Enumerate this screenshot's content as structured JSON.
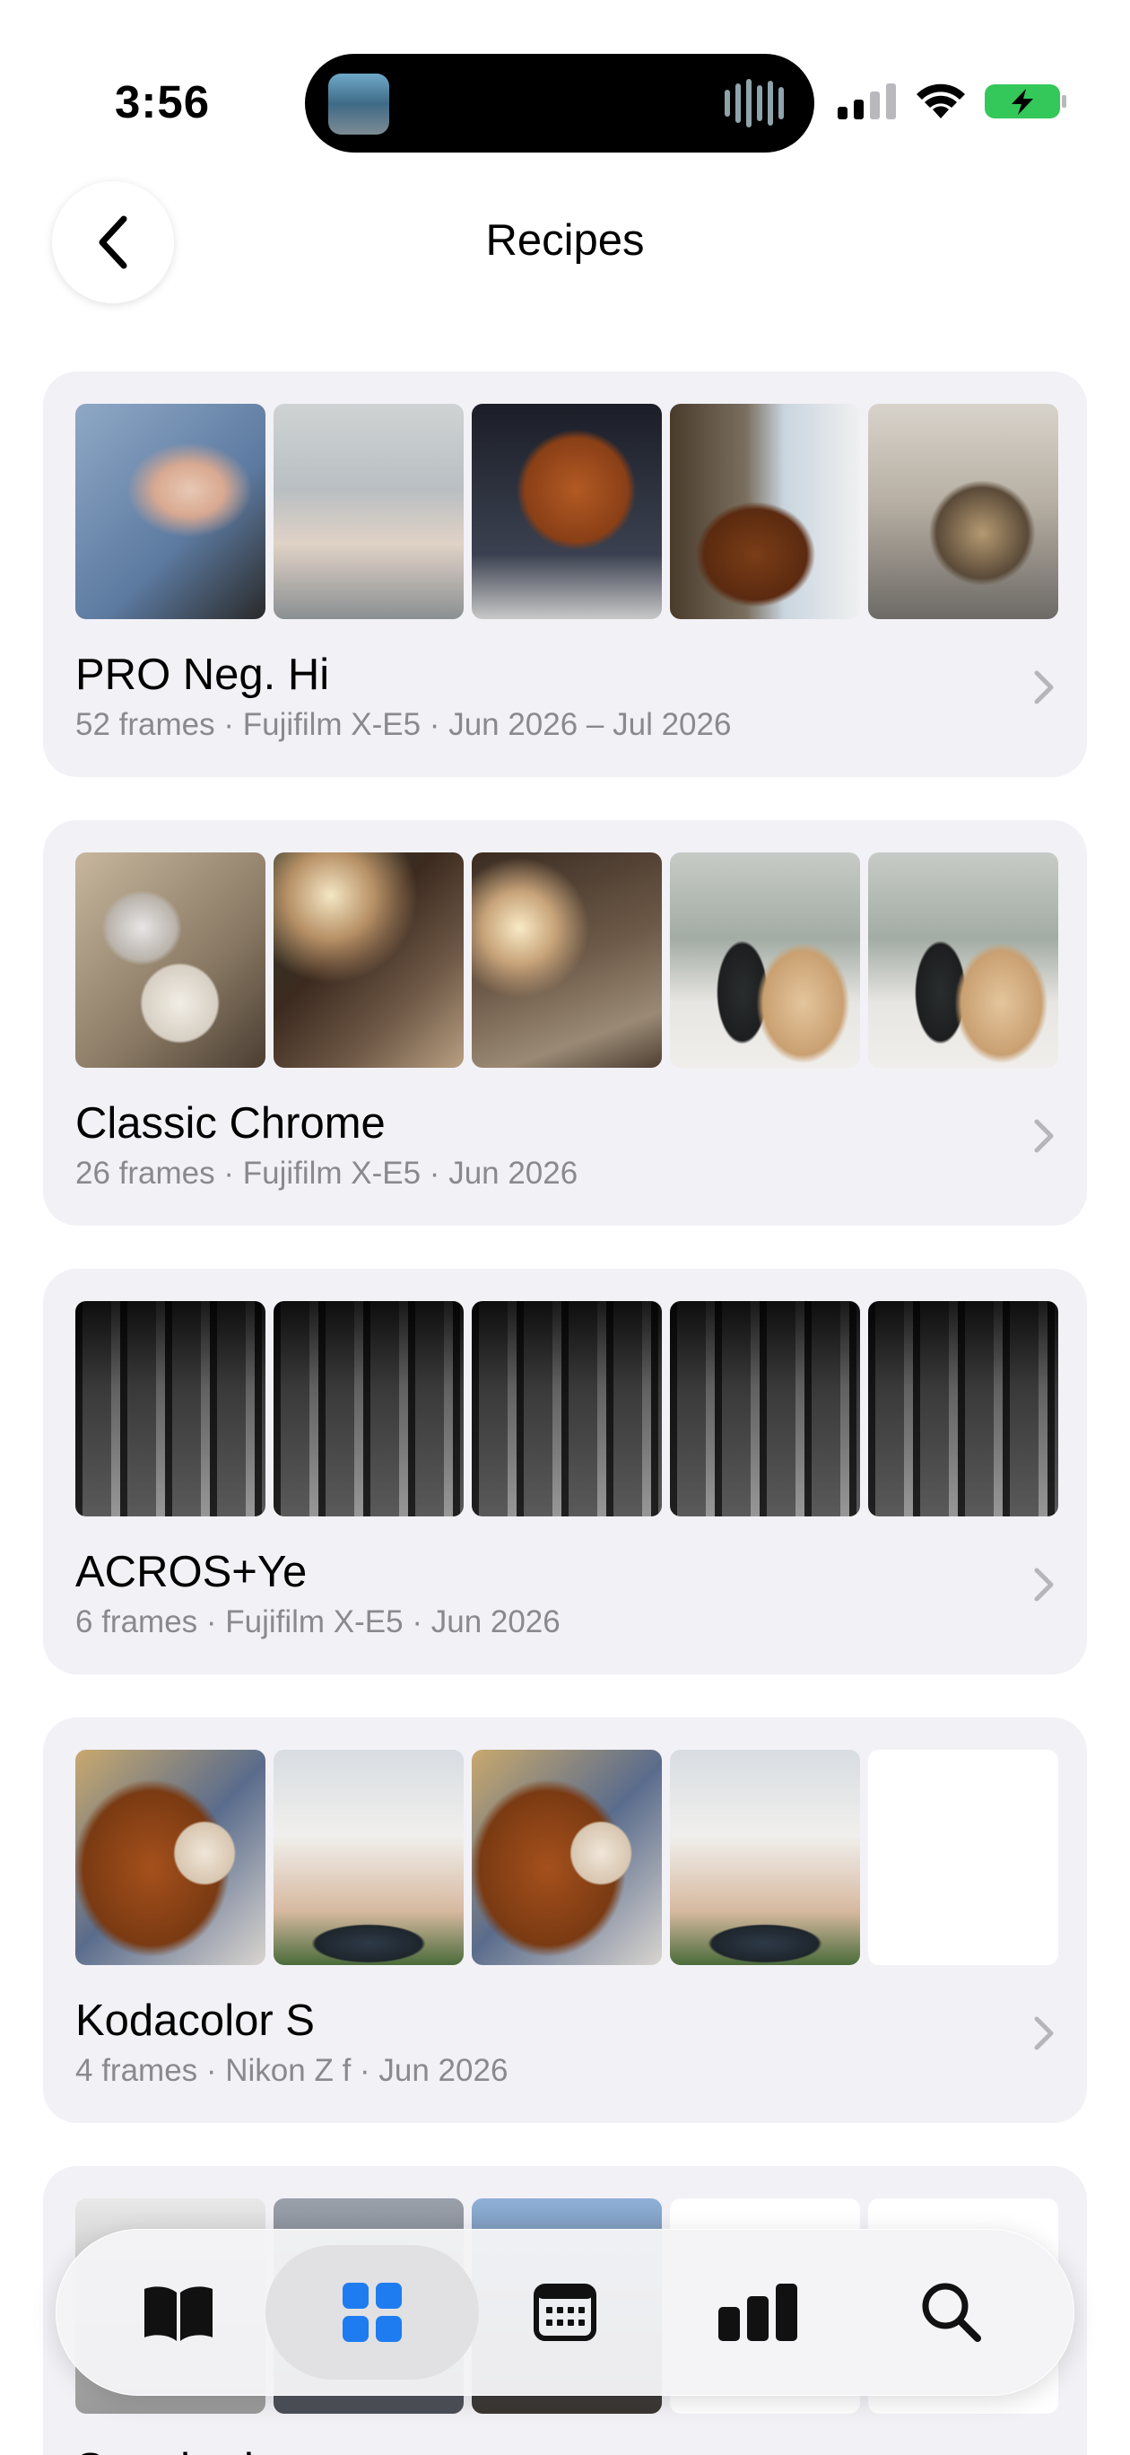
{
  "status_bar": {
    "time": "3:56",
    "icons": [
      "signal-icon",
      "wifi-icon",
      "battery-charging-icon"
    ]
  },
  "header": {
    "title": "Recipes",
    "back_icon": "chevron-left-icon"
  },
  "recipes": [
    {
      "name": "PRO Neg. Hi",
      "meta": "52 frames  ·  Fujifilm X-E5  ·  Jun 2026 – Jul 2026",
      "thumbnails": [
        "thumbs-up-photo",
        "bicycle-photo",
        "teddy-bear-photo",
        "teddy-bear-balcony-photo",
        "motorcycle-photo"
      ]
    },
    {
      "name": "Classic Chrome",
      "meta": "26 frames  ·  Fujifilm X-E5  ·  Jun 2026",
      "thumbnails": [
        "woman-with-dog-photo",
        "dining-room-photo",
        "living-room-lamp-photo",
        "vases-photo",
        "vases-photo"
      ]
    },
    {
      "name": "ACROS+Ye",
      "meta": "6 frames  ·  Fujifilm X-E5  ·  Jun 2026",
      "thumbnails": [
        "arcade-walkway-photo",
        "arcade-walkway-photo",
        "arcade-walkway-photo",
        "arcade-walkway-photo",
        "arcade-walkway-photo"
      ]
    },
    {
      "name": "Kodacolor S",
      "meta": "4 frames  ·  Nikon Z f  ·  Jun 2026",
      "thumbnails": [
        "teddy-bear-photo",
        "apartment-building-photo",
        "teddy-bear-photo",
        "apartment-building-photo",
        "empty-slot"
      ]
    },
    {
      "name": "Standard",
      "meta": "",
      "thumbnails": [
        "photo",
        "photo",
        "house-photo",
        "empty-slot",
        "empty-slot"
      ]
    }
  ],
  "tab_bar": {
    "tabs": [
      {
        "icon": "book-icon",
        "active": false
      },
      {
        "icon": "grid-icon",
        "active": true
      },
      {
        "icon": "calendar-icon",
        "active": false
      },
      {
        "icon": "bar-chart-icon",
        "active": false
      },
      {
        "icon": "search-icon",
        "active": false
      }
    ],
    "accent_color": "#1e7cf0"
  }
}
